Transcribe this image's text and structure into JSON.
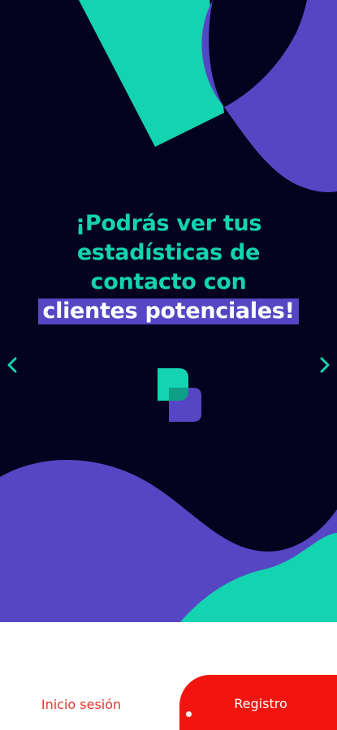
{
  "slide": {
    "headline_line1": "¡Podrás ver tus",
    "headline_line2": "estadísticas de",
    "headline_line3": "contacto con",
    "headline_highlight": "clientes potenciales!"
  },
  "navigation": {
    "prev_icon": "chevron-left-icon",
    "next_icon": "chevron-right-icon"
  },
  "actions": {
    "login_label": "Inicio sesión",
    "register_label": "Registro"
  },
  "colors": {
    "background": "#03021f",
    "teal": "#14d3b0",
    "purple": "#5646c3",
    "red": "#f2150f"
  }
}
